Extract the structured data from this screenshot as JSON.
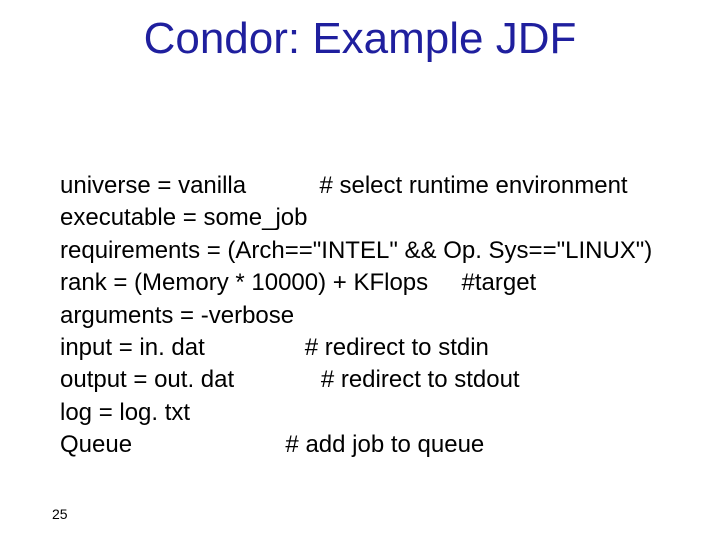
{
  "title": "Condor: Example JDF",
  "lines": {
    "l1": "universe = vanilla           # select runtime environment",
    "l2": "executable = some_job",
    "l3": "requirements = (Arch==\"INTEL\" && Op. Sys==\"LINUX\")",
    "l4": "rank = (Memory * 10000) + KFlops     #target",
    "l5": "arguments = -verbose",
    "l6": "input = in. dat               # redirect to stdin",
    "l7": "output = out. dat             # redirect to stdout",
    "l8": "log = log. txt",
    "l9": "Queue                       # add job to queue"
  },
  "page_number": "25"
}
